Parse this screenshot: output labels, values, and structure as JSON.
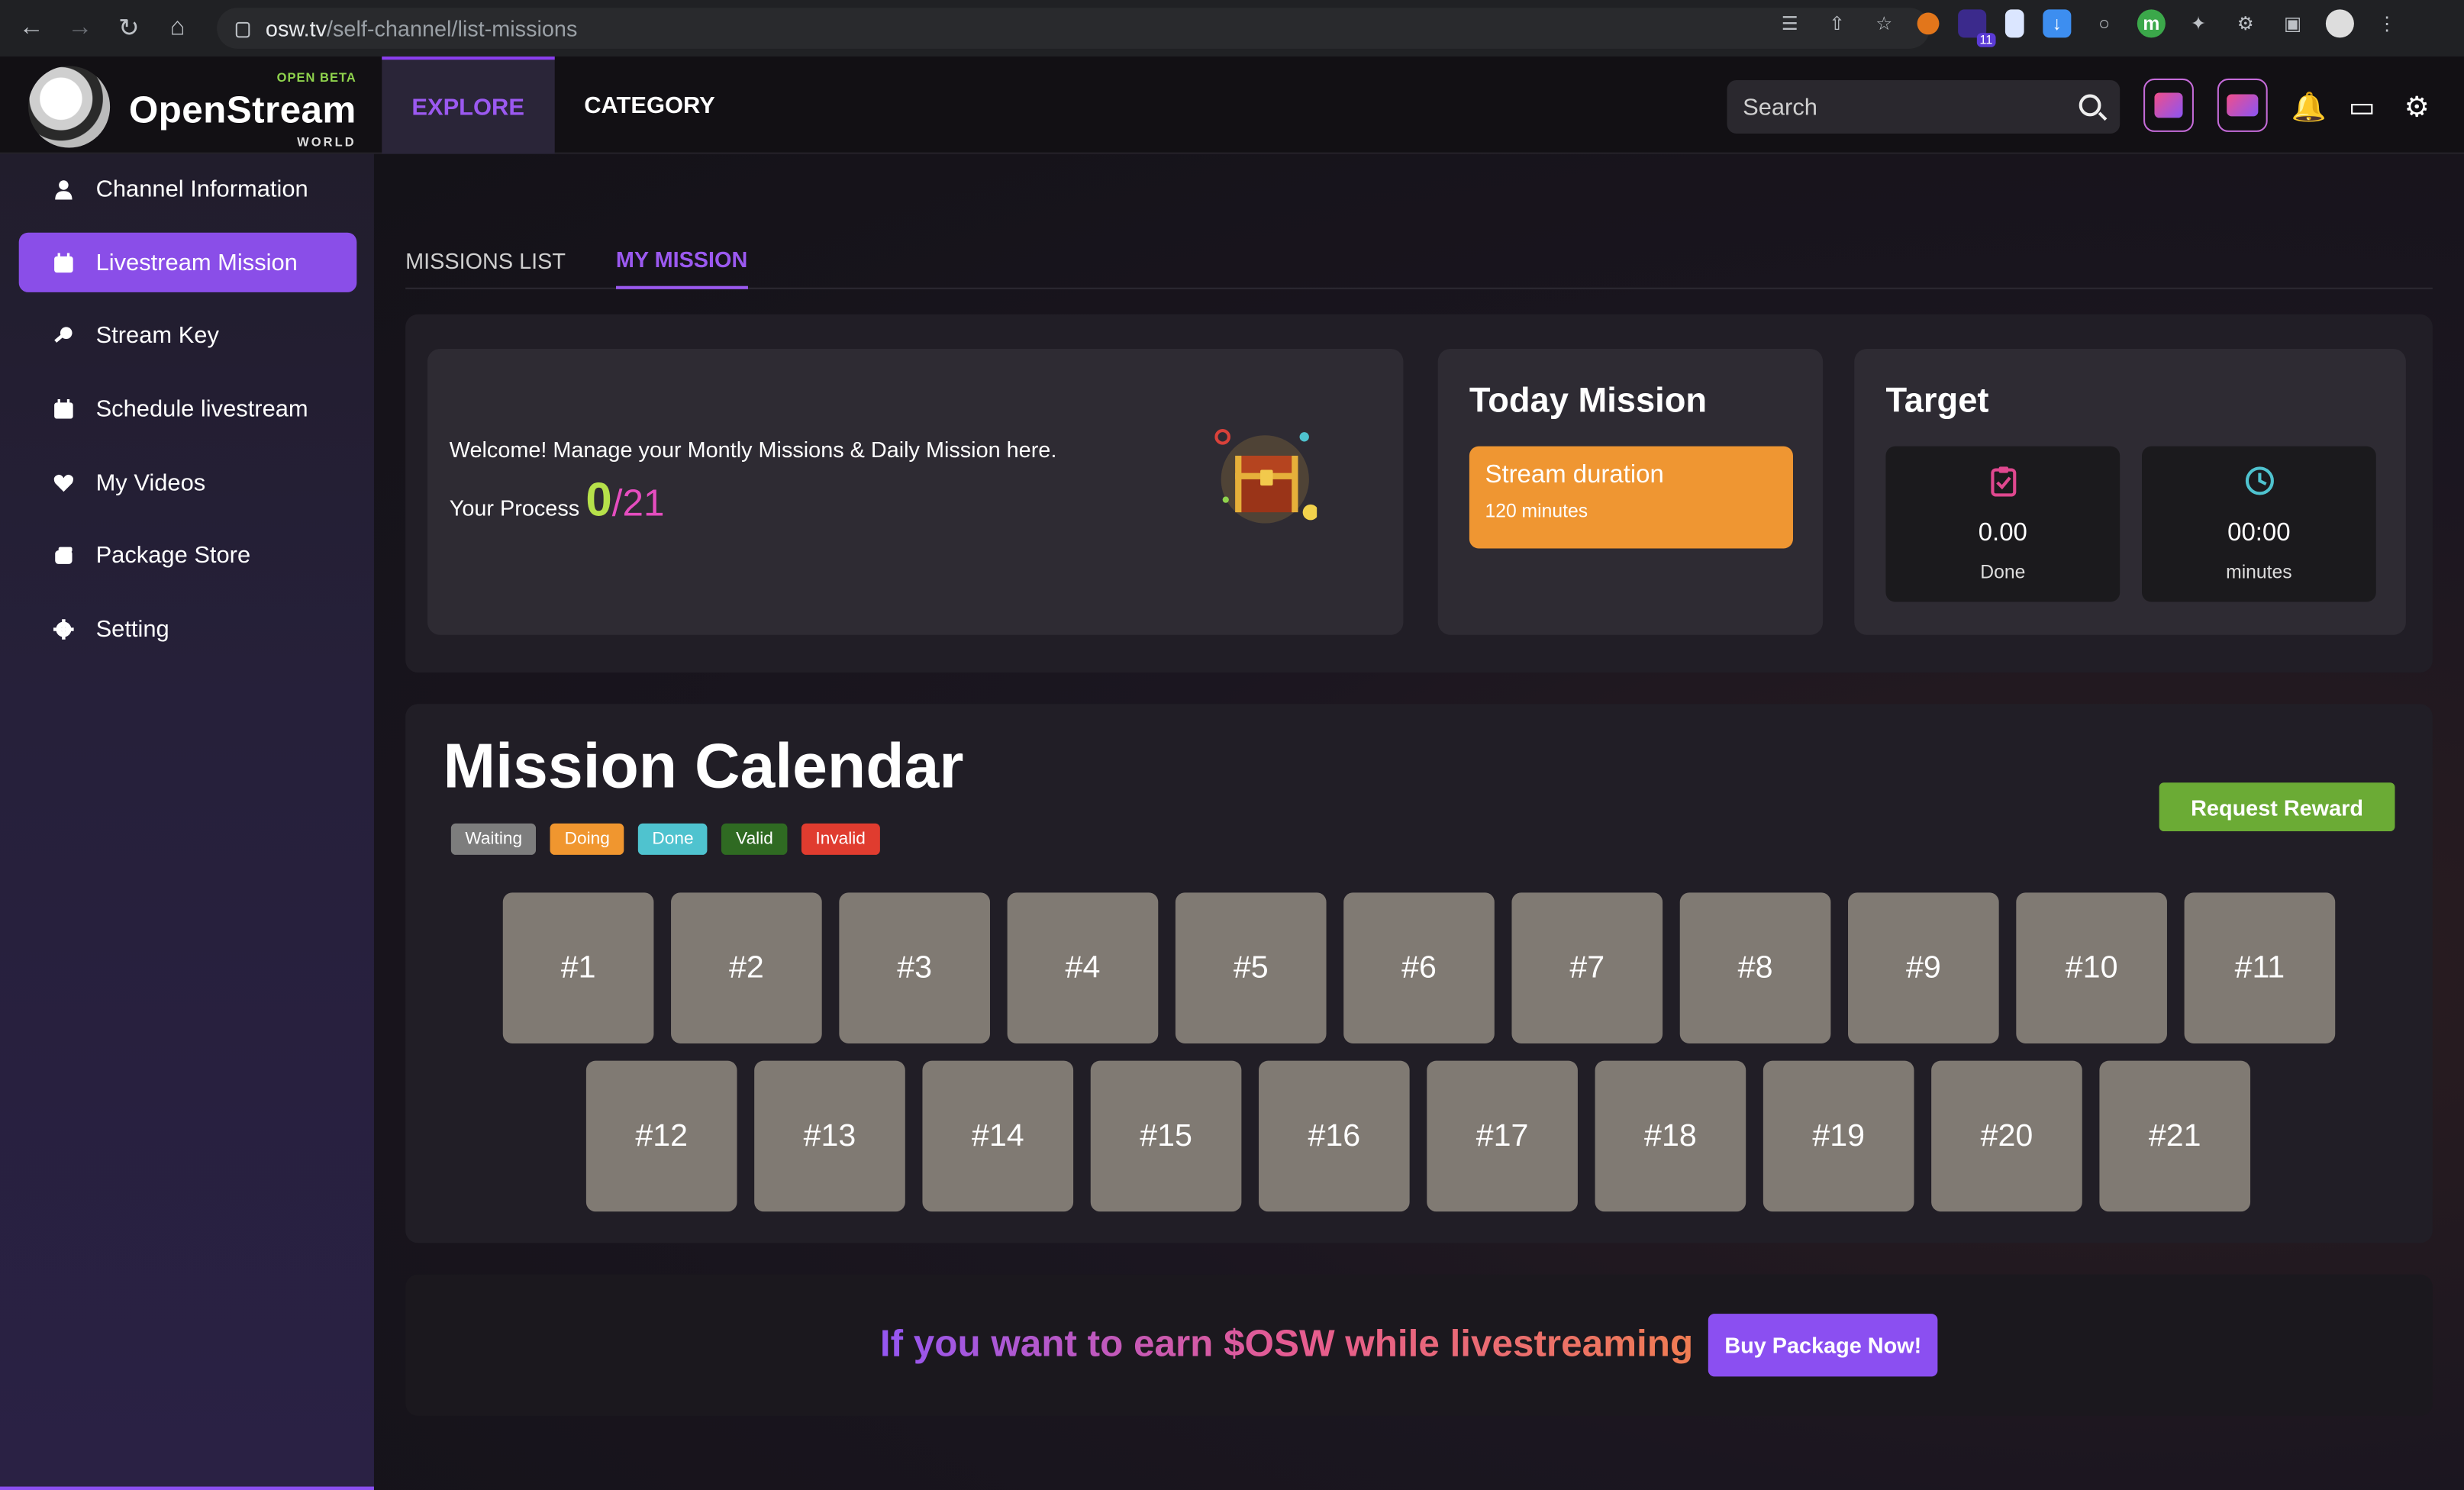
{
  "browser": {
    "url_domain": "osw.tv",
    "url_path": "/self-channel/list-missions",
    "ext_badge": "11"
  },
  "header": {
    "logo_beta": "OPEN BETA",
    "logo_name": "OpenStream",
    "logo_world": "WORLD",
    "nav": [
      {
        "label": "EXPLORE",
        "active": true
      },
      {
        "label": "CATEGORY",
        "active": false
      }
    ],
    "search_placeholder": "Search"
  },
  "sidebar": {
    "items": [
      {
        "label": "Channel Information",
        "icon": "user-icon",
        "active": false
      },
      {
        "label": "Livestream Mission",
        "icon": "calendar-icon",
        "active": true
      },
      {
        "label": "Stream Key",
        "icon": "key-icon",
        "active": false
      },
      {
        "label": "Schedule livestream",
        "icon": "calendar-icon",
        "active": false
      },
      {
        "label": "My Videos",
        "icon": "heart-icon",
        "active": false
      },
      {
        "label": "Package Store",
        "icon": "package-icon",
        "active": false
      },
      {
        "label": "Setting",
        "icon": "gear-icon",
        "active": false
      }
    ],
    "collapse_glyph": "<"
  },
  "tabs": [
    {
      "label": "MISSIONS LIST",
      "active": false
    },
    {
      "label": "MY MISSION",
      "active": true
    }
  ],
  "welcome": {
    "message": "Welcome! Manage your Montly Missions & Daily Mission here.",
    "process_label": "Your Process",
    "process_done": "0",
    "process_total": "/21"
  },
  "today_mission": {
    "title": "Today Mission",
    "mission_name": "Stream duration",
    "mission_detail": "120 minutes"
  },
  "target": {
    "title": "Target",
    "done_value": "0.00",
    "done_label": "Done",
    "minutes_value": "00:00",
    "minutes_label": "minutes"
  },
  "calendar": {
    "title": "Mission Calendar",
    "legend": [
      {
        "label": "Waiting",
        "color": "#7d7d7d"
      },
      {
        "label": "Doing",
        "color": "#f0962f"
      },
      {
        "label": "Done",
        "color": "#4fc3cf"
      },
      {
        "label": "Valid",
        "color": "#2f6a22"
      },
      {
        "label": "Invalid",
        "color": "#e03c2f"
      }
    ],
    "request_button": "Request Reward",
    "slots": [
      "#1",
      "#2",
      "#3",
      "#4",
      "#5",
      "#6",
      "#7",
      "#8",
      "#9",
      "#10",
      "#11",
      "#12",
      "#13",
      "#14",
      "#15",
      "#16",
      "#17",
      "#18",
      "#19",
      "#20",
      "#21"
    ]
  },
  "promo": {
    "text": "If you want to earn $OSW while livestreaming",
    "button": "Buy Package Now!"
  }
}
